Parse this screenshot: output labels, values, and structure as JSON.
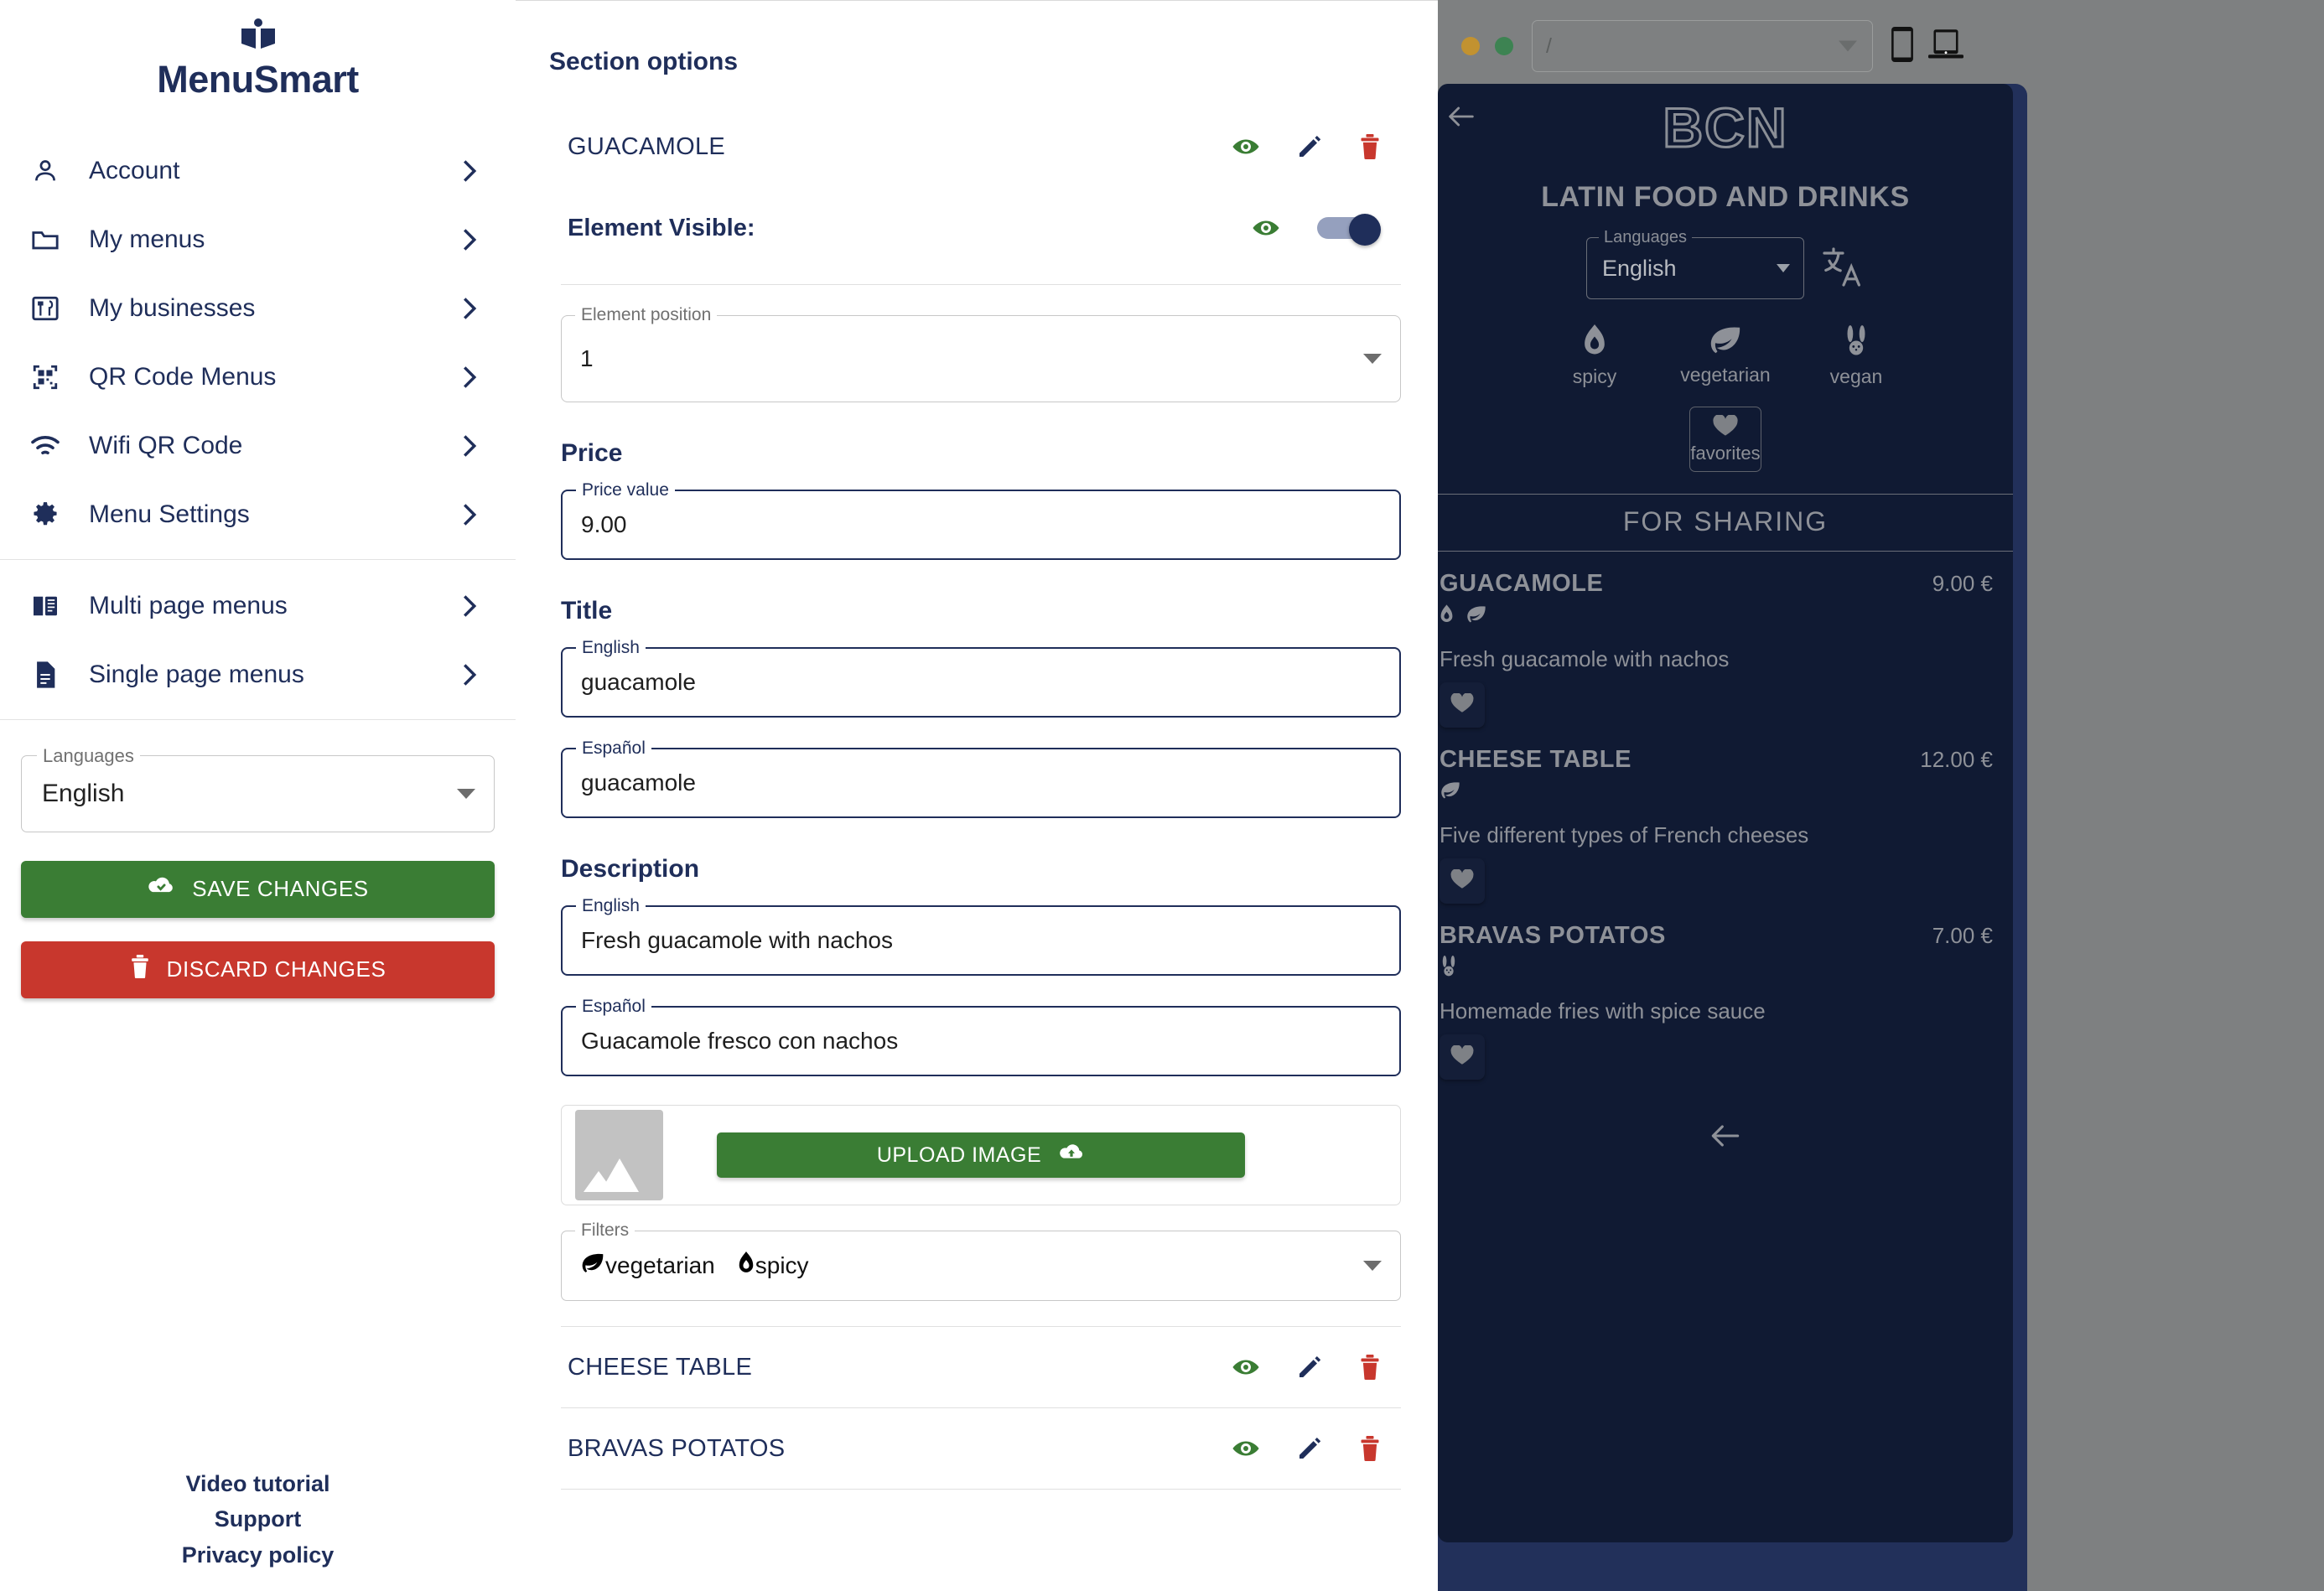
{
  "brand": {
    "name": "MenuSmart",
    "logo_icon": "open-book-icon"
  },
  "sidebar": {
    "items": [
      {
        "label": "Account",
        "icon": "person-icon"
      },
      {
        "label": "My menus",
        "icon": "folder-icon"
      },
      {
        "label": "My businesses",
        "icon": "restaurant-icon"
      },
      {
        "label": "QR Code Menus",
        "icon": "qr-code-icon"
      },
      {
        "label": "Wifi QR Code",
        "icon": "wifi-icon"
      },
      {
        "label": "Menu Settings",
        "icon": "gear-icon"
      }
    ],
    "items2": [
      {
        "label": "Multi page menus",
        "icon": "book-open-icon"
      },
      {
        "label": "Single page menus",
        "icon": "document-icon"
      }
    ],
    "language": {
      "legend": "Languages",
      "value": "English"
    },
    "save_label": "SAVE CHANGES",
    "discard_label": "DISCARD CHANGES",
    "footer": [
      {
        "label": "Video tutorial"
      },
      {
        "label": "Support"
      },
      {
        "label": "Privacy policy"
      }
    ]
  },
  "main": {
    "section_options_title": "Section options",
    "selected_item": "GUACAMOLE",
    "element_visible_label": "Element Visible:",
    "element_visible_on": true,
    "element_position": {
      "legend": "Element position",
      "value": "1"
    },
    "price_heading": "Price",
    "price_field": {
      "legend": "Price value",
      "value": "9.00"
    },
    "title_heading": "Title",
    "title_en": {
      "legend": "English",
      "value": "guacamole"
    },
    "title_es": {
      "legend": "Español",
      "value": "guacamole"
    },
    "description_heading": "Description",
    "desc_en": {
      "legend": "English",
      "value": "Fresh guacamole with nachos"
    },
    "desc_es": {
      "legend": "Español",
      "value": "Guacamole fresco con nachos"
    },
    "upload_label": "UPLOAD IMAGE",
    "filters": {
      "legend": "Filters",
      "chips": [
        "vegetarian",
        "spicy"
      ]
    },
    "other_items": [
      {
        "label": "CHEESE TABLE"
      },
      {
        "label": "BRAVAS POTATOS"
      }
    ]
  },
  "preview": {
    "browser": {
      "url_value": "/",
      "device_phone_icon": "phone-icon",
      "device_desktop_icon": "laptop-icon"
    },
    "logo_text": "BCN",
    "tagline": "LATIN FOOD AND DRINKS",
    "language": {
      "legend": "Languages",
      "value": "English"
    },
    "translate_icon": "translate-icon",
    "filters": [
      {
        "label": "spicy",
        "icon": "flame-icon"
      },
      {
        "label": "vegetarian",
        "icon": "leaf-icon"
      },
      {
        "label": "vegan",
        "icon": "rabbit-icon"
      }
    ],
    "favorites_label": "favorites",
    "section_label": "FOR SHARING",
    "items": [
      {
        "name": "GUACAMOLE",
        "price": "9.00 €",
        "tags": [
          "flame-icon",
          "leaf-icon"
        ],
        "description": "Fresh guacamole with nachos"
      },
      {
        "name": "CHEESE TABLE",
        "price": "12.00 €",
        "tags": [
          "leaf-icon"
        ],
        "description": "Five different types of French cheeses"
      },
      {
        "name": "BRAVAS POTATOS",
        "price": "7.00 €",
        "tags": [
          "rabbit-icon"
        ],
        "description": "Homemade fries with spice sauce"
      }
    ]
  },
  "colors": {
    "navy": "#1f2e5a",
    "green": "#3a7d34",
    "red": "#c8372d",
    "preview_bg": "#101a33",
    "preview_text": "#8e9198",
    "chrome_gray": "#7e8081"
  }
}
